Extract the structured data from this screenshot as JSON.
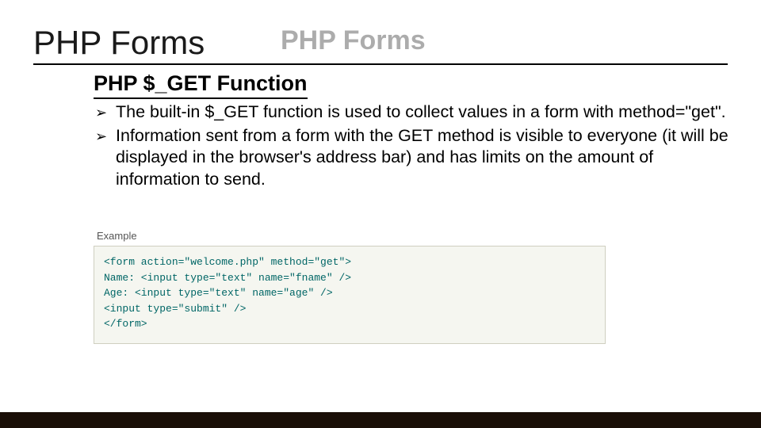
{
  "title": "PHP Forms",
  "shadow_title": "PHP Forms",
  "subtitle": "PHP $_GET Function",
  "bullets": [
    "The built-in $_GET function is used to collect values in a form with method=\"get\".",
    "Information sent from a form with the GET method is visible to everyone (it will be displayed in the browser's address bar) and has limits on the amount of information to send."
  ],
  "example_label": "Example",
  "code_lines": [
    "<form action=\"welcome.php\" method=\"get\">",
    "Name: <input type=\"text\" name=\"fname\" />",
    "Age: <input type=\"text\" name=\"age\" />",
    "<input type=\"submit\" />",
    "</form>"
  ]
}
